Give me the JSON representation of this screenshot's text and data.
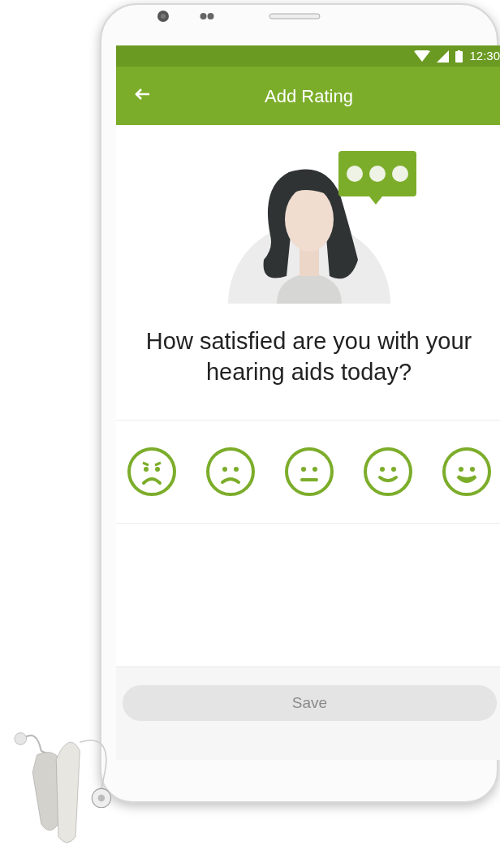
{
  "status_bar": {
    "time": "12:30"
  },
  "app_bar": {
    "title": "Add Rating"
  },
  "question": "How satisfied are you with your hearing aids today?",
  "rating_options": [
    {
      "kind": "angry",
      "selected": false
    },
    {
      "kind": "sad",
      "selected": false
    },
    {
      "kind": "neutral",
      "selected": false
    },
    {
      "kind": "happy",
      "selected": false
    },
    {
      "kind": "very_happy",
      "selected": false
    }
  ],
  "save_button": {
    "label": "Save",
    "disabled": true
  }
}
